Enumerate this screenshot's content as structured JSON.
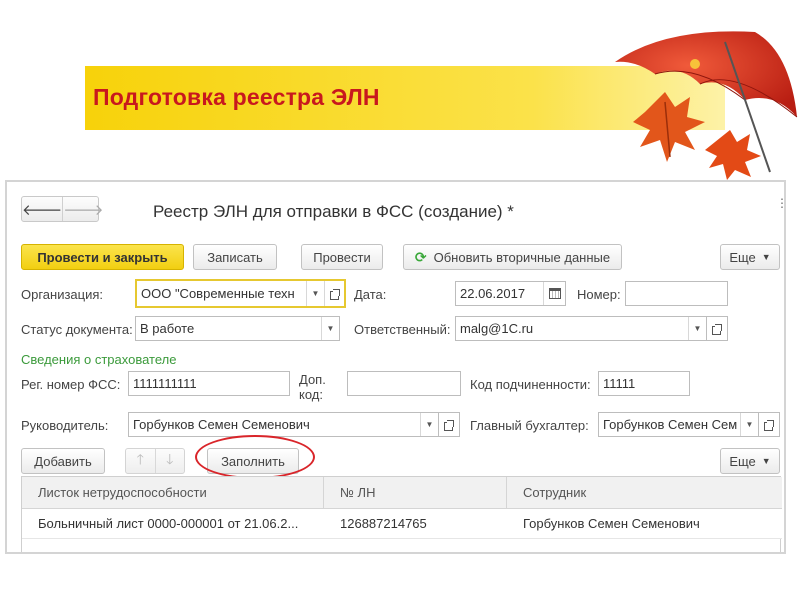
{
  "slide": {
    "title": "Подготовка реестра ЭЛН"
  },
  "window": {
    "title": "Реестр ЭЛН для отправки в ФСС (создание) *",
    "back_icon": "arrow-left-icon",
    "forward_icon": "arrow-right-icon",
    "menu_dots": "⋮"
  },
  "toolbar": {
    "post_close": "Провести и закрыть",
    "save": "Записать",
    "post": "Провести",
    "refresh": "Обновить вторичные данные",
    "more": "Еще"
  },
  "fields": {
    "organization_label": "Организация:",
    "organization_value": "ООО \"Современные техн",
    "date_label": "Дата:",
    "date_value": "22.06.2017",
    "number_label": "Номер:",
    "number_value": "",
    "status_label": "Статус документа:",
    "status_value": "В работе",
    "responsible_label": "Ответственный:",
    "responsible_value": "malg@1C.ru"
  },
  "insurer": {
    "section_title": "Сведения о страхователе",
    "reg_label": "Рег. номер ФСС:",
    "reg_value": "1111111111",
    "add_code_label_1": "Доп.",
    "add_code_label_2": "код:",
    "add_code_value": "",
    "sub_code_label": "Код подчиненности:",
    "sub_code_value": "11111",
    "head_label": "Руководитель:",
    "head_value": "Горбунков Семен Семенович",
    "accountant_label": "Главный бухгалтер:",
    "accountant_value": "Горбунков Семен Сем"
  },
  "table_toolbar": {
    "add": "Добавить",
    "fill": "Заполнить",
    "more": "Еще",
    "up_icon": "arrow-up-icon",
    "down_icon": "arrow-down-icon"
  },
  "table": {
    "columns": [
      "Листок нетрудоспособности",
      "№ ЛН",
      "Сотрудник"
    ],
    "rows": [
      [
        "Больничный лист 0000-000001 от 21.06.2...",
        "126887214765",
        "Горбунков Семен Семенович"
      ]
    ]
  },
  "colors": {
    "banner": "#f7d20a",
    "title_red": "#c8181e",
    "primary_button": "#f2cf11",
    "section_green": "#3b9a3b",
    "highlight_circle": "#d9252a"
  }
}
